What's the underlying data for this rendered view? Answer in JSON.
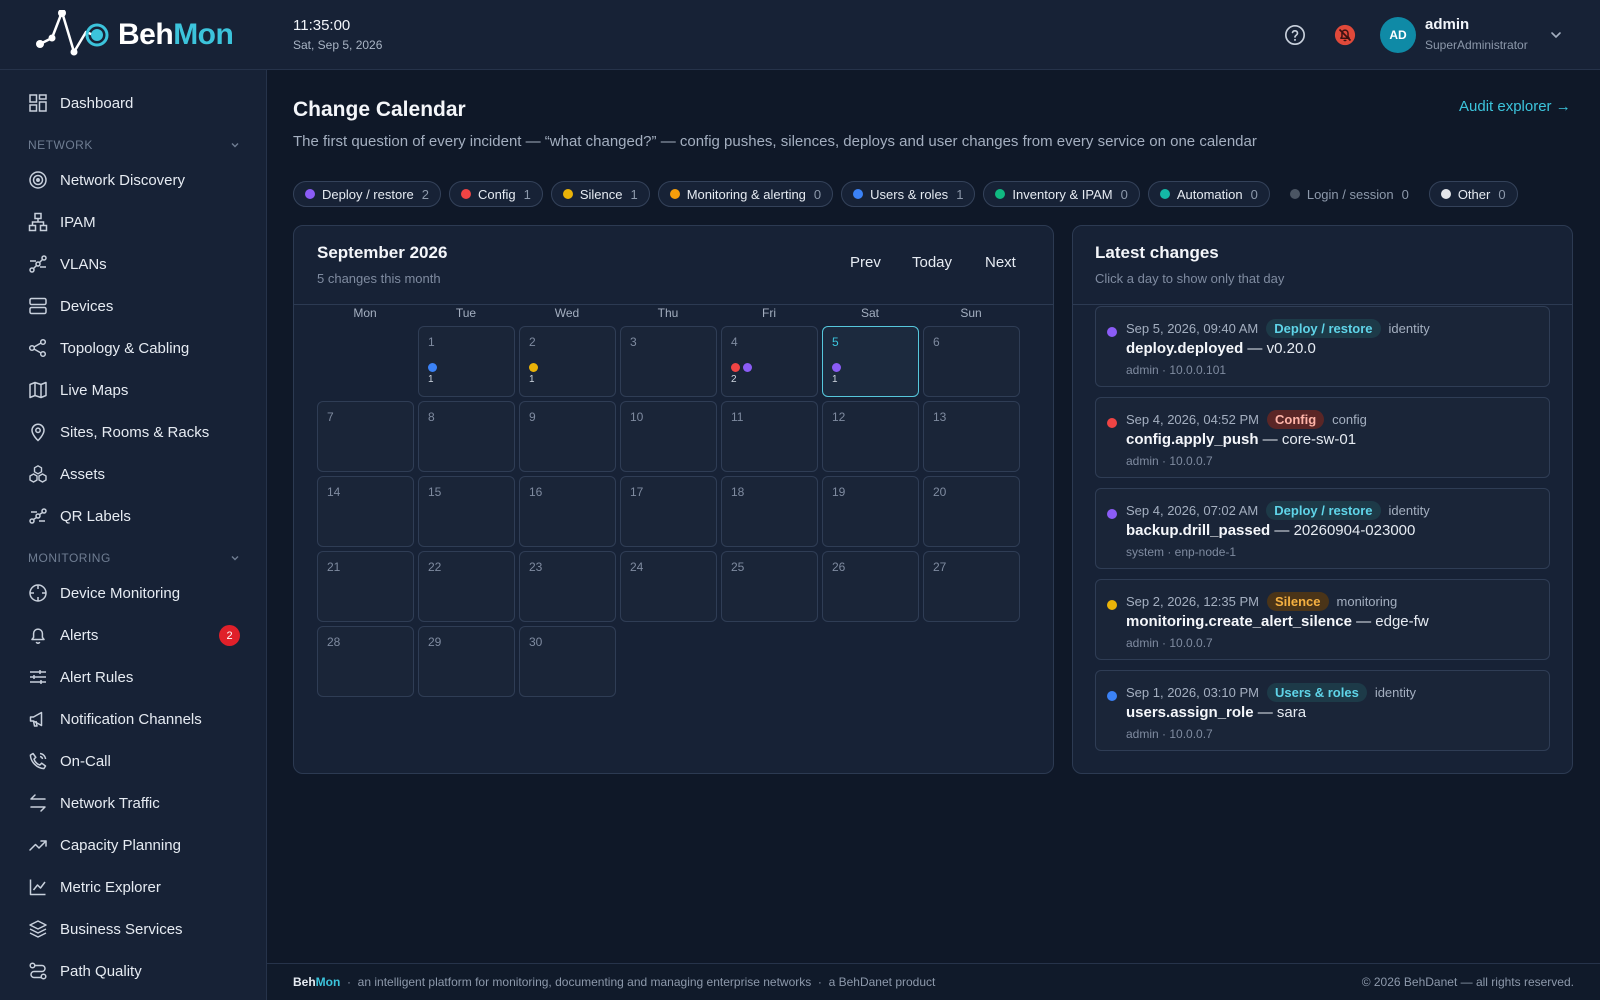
{
  "app": {
    "brand_a": "Beh",
    "brand_b": "Mon"
  },
  "header": {
    "time": "11:35:00",
    "date": "Sat, Sep 5, 2026",
    "user_initials": "AD",
    "user_name": "admin",
    "user_role": "SuperAdministrator",
    "icons": [
      "help-icon",
      "notifications-off-icon",
      "chevron-down-icon"
    ]
  },
  "sidebar": {
    "dashboard": "Dashboard",
    "network_section": "NETWORK",
    "network_items": [
      {
        "label": "Network Discovery",
        "icon": "discovery-icon"
      },
      {
        "label": "IPAM",
        "icon": "ipam-icon"
      },
      {
        "label": "VLANs",
        "icon": "vlan-icon"
      },
      {
        "label": "Devices",
        "icon": "server-icon"
      },
      {
        "label": "Topology & Cabling",
        "icon": "share-icon"
      },
      {
        "label": "Live Maps",
        "icon": "map-icon"
      },
      {
        "label": "Sites, Rooms & Racks",
        "icon": "location-pin-icon"
      },
      {
        "label": "Assets",
        "icon": "cubes-icon"
      },
      {
        "label": "QR Labels",
        "icon": "qr-label-icon"
      }
    ],
    "monitoring_section": "MONITORING",
    "monitoring_items": [
      {
        "label": "Device Monitoring",
        "icon": "crosshair-icon"
      },
      {
        "label": "Alerts",
        "icon": "bell-icon",
        "badge": "2"
      },
      {
        "label": "Alert Rules",
        "icon": "sliders-icon"
      },
      {
        "label": "Notification Channels",
        "icon": "megaphone-icon"
      },
      {
        "label": "On-Call",
        "icon": "phone-icon"
      },
      {
        "label": "Network Traffic",
        "icon": "arrows-icon"
      },
      {
        "label": "Capacity Planning",
        "icon": "trending-up-icon"
      },
      {
        "label": "Metric Explorer",
        "icon": "line-chart-icon"
      },
      {
        "label": "Business Services",
        "icon": "layers-icon"
      },
      {
        "label": "Path Quality",
        "icon": "route-icon"
      }
    ]
  },
  "page": {
    "title": "Change Calendar",
    "subtitle": "The first question of every incident — “what changed?” — config pushes, silences, deploys and user changes from every service on one calendar",
    "audit_link": "Audit explorer →"
  },
  "filters": [
    {
      "label": "Deploy / restore",
      "count": "2",
      "color": "#8b5cf6",
      "active": true
    },
    {
      "label": "Config",
      "count": "1",
      "color": "#ef4444",
      "active": true
    },
    {
      "label": "Silence",
      "count": "1",
      "color": "#eab308",
      "active": true
    },
    {
      "label": "Monitoring & alerting",
      "count": "0",
      "color": "#f59e0b",
      "active": true
    },
    {
      "label": "Users & roles",
      "count": "1",
      "color": "#3b82f6",
      "active": true
    },
    {
      "label": "Inventory & IPAM",
      "count": "0",
      "color": "#10b981",
      "active": true
    },
    {
      "label": "Automation",
      "count": "0",
      "color": "#14b8a6",
      "active": true
    },
    {
      "label": "Login / session",
      "count": "0",
      "color": "#4b5563",
      "active": false
    },
    {
      "label": "Other",
      "count": "0",
      "color": "#e5e7eb",
      "active": true
    }
  ],
  "calendar": {
    "month": "September 2026",
    "summary": "5 changes this month",
    "prev": "Prev",
    "today": "Today",
    "next": "Next",
    "weekdays": [
      "Mon",
      "Tue",
      "Wed",
      "Thu",
      "Fri",
      "Sat",
      "Sun"
    ],
    "first_weekday_index": 1,
    "days_in_month": 30,
    "today_day": 5,
    "day_events": {
      "1": {
        "dots": [
          "#3b82f6"
        ],
        "count": "1"
      },
      "2": {
        "dots": [
          "#eab308"
        ],
        "count": "1"
      },
      "4": {
        "dots": [
          "#ef4444",
          "#8b5cf6"
        ],
        "count": "2"
      },
      "5": {
        "dots": [
          "#8b5cf6"
        ],
        "count": "1"
      }
    }
  },
  "latest": {
    "title": "Latest changes",
    "hint": "Click a day to show only that day",
    "events": [
      {
        "when": "Sep 5, 2026, 09:40 AM",
        "tag": "Deploy / restore",
        "tag_fg": "#5fd4e8",
        "tag_bg": "#1d3a48",
        "dot": "#8b5cf6",
        "service": "identity",
        "action": "deploy.deployed",
        "target": "v0.20.0",
        "meta": "admin · 10.0.0.101"
      },
      {
        "when": "Sep 4, 2026, 04:52 PM",
        "tag": "Config",
        "tag_fg": "#ffb4a8",
        "tag_bg": "#5a2626",
        "dot": "#ef4444",
        "service": "config",
        "action": "config.apply_push",
        "target": "core-sw-01",
        "meta": "admin · 10.0.0.7"
      },
      {
        "when": "Sep 4, 2026, 07:02 AM",
        "tag": "Deploy / restore",
        "tag_fg": "#5fd4e8",
        "tag_bg": "#1d3a48",
        "dot": "#8b5cf6",
        "service": "identity",
        "action": "backup.drill_passed",
        "target": "20260904-023000",
        "meta": "system · enp-node-1"
      },
      {
        "when": "Sep 2, 2026, 12:35 PM",
        "tag": "Silence",
        "tag_fg": "#f5b041",
        "tag_bg": "#4a3418",
        "dot": "#eab308",
        "service": "monitoring",
        "action": "monitoring.create_alert_silence",
        "target": "edge-fw",
        "meta": "admin · 10.0.0.7"
      },
      {
        "when": "Sep 1, 2026, 03:10 PM",
        "tag": "Users & roles",
        "tag_fg": "#5fd4e8",
        "tag_bg": "#1d3a48",
        "dot": "#3b82f6",
        "service": "identity",
        "action": "users.assign_role",
        "target": "sara",
        "meta": "admin · 10.0.0.7"
      }
    ]
  },
  "footer": {
    "brand_a": "Beh",
    "brand_b": "Mon",
    "tagline": "an intelligent platform for monitoring, documenting and managing enterprise networks",
    "product": "a BehDanet product",
    "copyright": "© 2026 BehDanet — all rights reserved."
  }
}
